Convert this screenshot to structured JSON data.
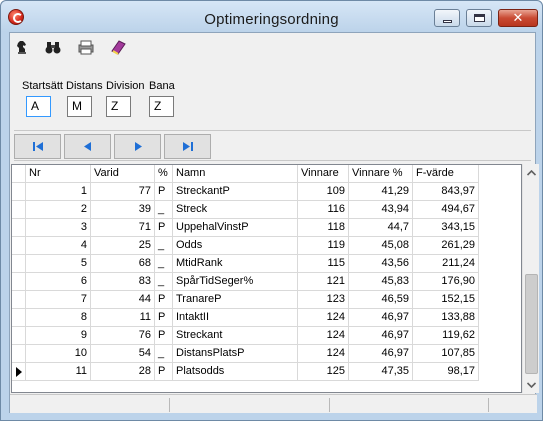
{
  "window": {
    "title": "Optimeringsordning",
    "minimize_icon": "minimize-icon",
    "maximize_icon": "maximize-icon",
    "close_label": "✕"
  },
  "toolbar": {
    "icons": [
      "horse-icon",
      "binoculars-icon",
      "print-icon",
      "book-icon"
    ]
  },
  "fields": {
    "startsatt": {
      "label": "Startsätt",
      "value": "A"
    },
    "distans": {
      "label": "Distans",
      "value": "M"
    },
    "division": {
      "label": "Division",
      "value": "Z"
    },
    "bana": {
      "label": "Bana",
      "value": "Z"
    }
  },
  "nav": {
    "buttons": [
      "first-record-icon",
      "previous-record-icon",
      "next-record-icon",
      "last-record-icon"
    ]
  },
  "grid": {
    "columns": [
      "Nr",
      "Varid",
      "%",
      "Namn",
      "Vinnare",
      "Vinnare %",
      "F-värde"
    ],
    "rows": [
      {
        "nr": "1",
        "varid": "77",
        "pct": "P",
        "namn": "StreckantP",
        "vinnare": "109",
        "vinnare_pct": "41,29",
        "fvarde": "843,97"
      },
      {
        "nr": "2",
        "varid": "39",
        "pct": "_",
        "namn": "Streck",
        "vinnare": "116",
        "vinnare_pct": "43,94",
        "fvarde": "494,67"
      },
      {
        "nr": "3",
        "varid": "71",
        "pct": "P",
        "namn": "UppehalVinstP",
        "vinnare": "118",
        "vinnare_pct": "44,7",
        "fvarde": "343,15"
      },
      {
        "nr": "4",
        "varid": "25",
        "pct": "_",
        "namn": "Odds",
        "vinnare": "119",
        "vinnare_pct": "45,08",
        "fvarde": "261,29"
      },
      {
        "nr": "5",
        "varid": "68",
        "pct": "_",
        "namn": "MtidRank",
        "vinnare": "115",
        "vinnare_pct": "43,56",
        "fvarde": "211,24"
      },
      {
        "nr": "6",
        "varid": "83",
        "pct": "_",
        "namn": "SpårTidSeger%",
        "vinnare": "121",
        "vinnare_pct": "45,83",
        "fvarde": "176,90"
      },
      {
        "nr": "7",
        "varid": "44",
        "pct": "P",
        "namn": "TranareP",
        "vinnare": "123",
        "vinnare_pct": "46,59",
        "fvarde": "152,15"
      },
      {
        "nr": "8",
        "varid": "11",
        "pct": "P",
        "namn": "IntaktII",
        "vinnare": "124",
        "vinnare_pct": "46,97",
        "fvarde": "133,88"
      },
      {
        "nr": "9",
        "varid": "76",
        "pct": "P",
        "namn": "Streckant",
        "vinnare": "124",
        "vinnare_pct": "46,97",
        "fvarde": "119,62"
      },
      {
        "nr": "10",
        "varid": "54",
        "pct": "_",
        "namn": "DistansPlatsP",
        "vinnare": "124",
        "vinnare_pct": "46,97",
        "fvarde": "107,85"
      },
      {
        "nr": "11",
        "varid": "28",
        "pct": "P",
        "namn": "Platsodds",
        "vinnare": "125",
        "vinnare_pct": "47,35",
        "fvarde": "98,17"
      }
    ],
    "current_row": 11
  },
  "scrollbar": {
    "up_icon": "scroll-up-icon",
    "down_icon": "scroll-down-icon"
  }
}
